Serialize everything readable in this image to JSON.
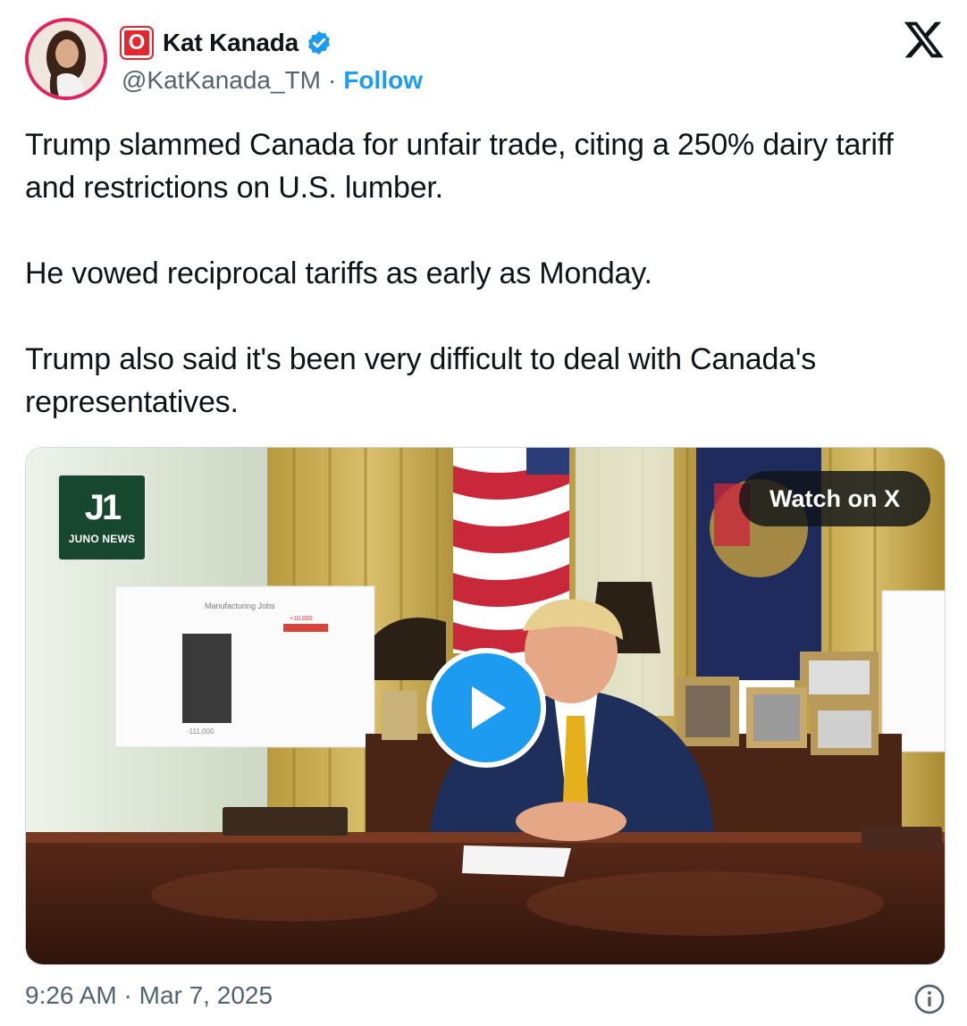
{
  "author": {
    "brand_badge_letter": "O",
    "display_name": "Kat Kanada",
    "handle": "@KatKanada_TM",
    "separator": "·",
    "follow_label": "Follow"
  },
  "tweet": {
    "paragraphs": [
      "Trump slammed Canada for unfair trade, citing a 250% dairy tariff and restrictions on U.S. lumber.",
      "He vowed reciprocal tariffs as early as Monday.",
      "Trump also said it's been very difficult to deal with Canada's representatives."
    ]
  },
  "media": {
    "channel_mark": "J1",
    "channel_name": "JUNO NEWS",
    "watch_label": "Watch on X",
    "chart_title": "Manufacturing Jobs",
    "chart_bar_left_label": "-111,000",
    "chart_bar_right_label": "+10,000"
  },
  "footer": {
    "timestamp": "9:26 AM · Mar 7, 2025"
  },
  "colors": {
    "follow": "#1d9bf0",
    "verified": "#1d9bf0",
    "brand_badge": "#e1282f",
    "juno_bg": "#17472f"
  },
  "icons": [
    "verified-badge-icon",
    "x-logo-icon",
    "play-icon",
    "info-icon"
  ]
}
